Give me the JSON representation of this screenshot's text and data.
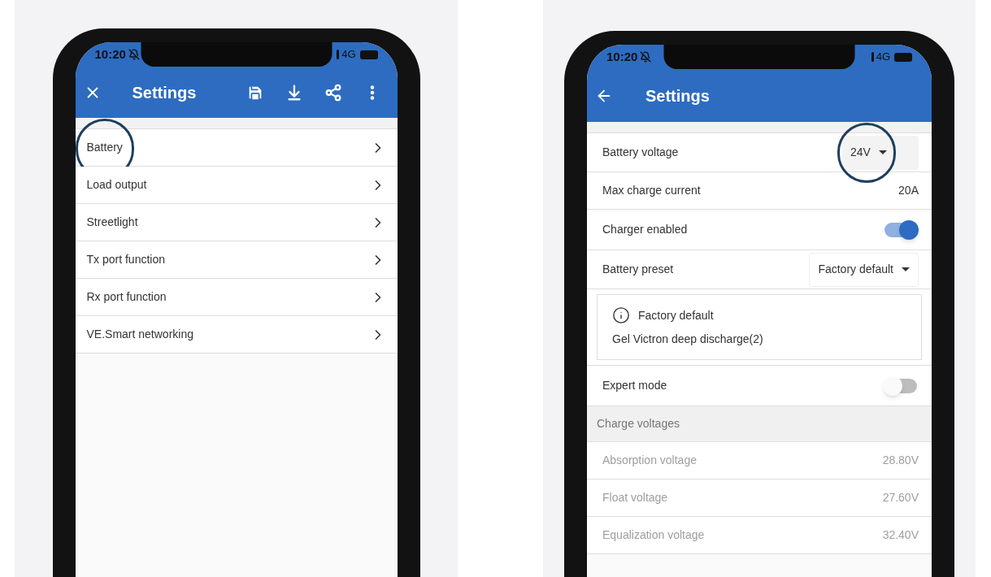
{
  "phones": [
    {
      "kind": "menu",
      "status_bar": {
        "time": "10:20",
        "network": "4G"
      },
      "title": "Settings",
      "items": [
        {
          "label": "Battery",
          "highlighted": true
        },
        {
          "label": "Load output",
          "highlighted": false
        },
        {
          "label": "Streetlight",
          "highlighted": false
        },
        {
          "label": "Tx port function",
          "highlighted": false
        },
        {
          "label": "Rx port function",
          "highlighted": false
        },
        {
          "label": "VE.Smart networking",
          "highlighted": false
        }
      ]
    },
    {
      "kind": "detail",
      "status_bar": {
        "time": "10:20",
        "network": "4G"
      },
      "title": "Settings",
      "rows": [
        {
          "kind": "select",
          "label": "Battery voltage",
          "value": "24V",
          "highlighted": true,
          "boxed": false
        },
        {
          "kind": "value",
          "label": "Max charge current",
          "value": "20A",
          "disabled": false
        },
        {
          "kind": "toggle",
          "label": "Charger enabled",
          "on": true
        },
        {
          "kind": "select",
          "label": "Battery preset",
          "value": "Factory default",
          "highlighted": false,
          "boxed": true
        },
        {
          "kind": "info",
          "title": "Factory default",
          "text": "Gel Victron deep discharge(2)"
        },
        {
          "kind": "toggle",
          "label": "Expert mode",
          "on": false
        },
        {
          "kind": "section",
          "label": "Charge voltages"
        },
        {
          "kind": "value",
          "label": "Absorption voltage",
          "value": "28.80V",
          "disabled": true
        },
        {
          "kind": "value",
          "label": "Float voltage",
          "value": "27.60V",
          "disabled": true
        },
        {
          "kind": "value",
          "label": "Equalization voltage",
          "value": "32.40V",
          "disabled": true
        }
      ]
    }
  ]
}
